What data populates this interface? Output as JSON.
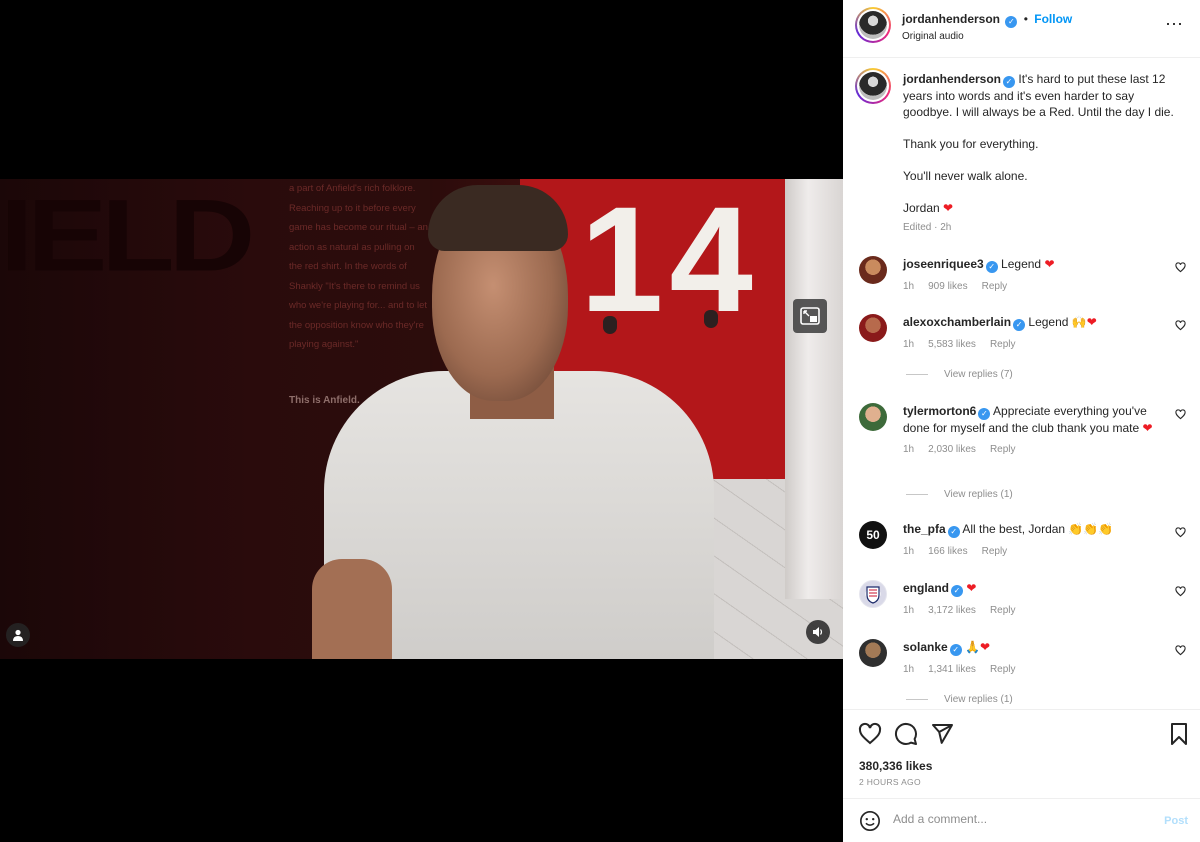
{
  "colors": {
    "accent": "#0095f6",
    "verified": "#3897f0",
    "heart": "#ed1c24",
    "muted": "#8e8e8e"
  },
  "video": {
    "wall_letters": "IELD",
    "quote": "a part of Anfield's rich folklore. Reaching up to it before every game has become our ritual – an action as natural as pulling on the red shirt. In the words of Shankly \"It's there to remind us who we're playing for... and to let the opposition know who they're playing against.\"",
    "quote_signature": "This is Anfield.",
    "jersey_number": "14",
    "buttons": {
      "user_icon": "user-icon",
      "sound_icon": "speaker-icon",
      "pip_icon": "picture-in-picture-icon"
    }
  },
  "header": {
    "username": "jordanhenderson",
    "separator": "•",
    "follow_label": "Follow",
    "audio": "Original audio",
    "more_icon": "more-horizontal-icon"
  },
  "caption": {
    "username": "jordanhenderson",
    "text1": "It's hard to put these last 12 years into words and it's even harder to say goodbye. I will always be a Red. Until the day I die.",
    "text2": "Thank you for everything.",
    "text3": "You'll never walk alone.",
    "text4": "Jordan",
    "meta": "Edited · 2h"
  },
  "comments": [
    {
      "username": "joseenriquee3",
      "text": "Legend",
      "emoji": "❤",
      "time": "1h",
      "likes": "909 likes",
      "reply": "Reply",
      "replies": ""
    },
    {
      "username": "alexoxchamberlain",
      "text": "Legend",
      "emoji": "🙌❤",
      "time": "1h",
      "likes": "5,583 likes",
      "reply": "Reply",
      "replies": "View replies (7)"
    },
    {
      "username": "tylermorton6",
      "text": "Appreciate everything you've done for myself and the club thank you mate",
      "emoji": "❤",
      "time": "1h",
      "likes": "2,030 likes",
      "reply": "Reply",
      "replies": "View replies (1)"
    },
    {
      "username": "the_pfa",
      "text": "All the best, Jordan",
      "emoji": "👏👏👏",
      "time": "1h",
      "likes": "166 likes",
      "reply": "Reply",
      "replies": ""
    },
    {
      "username": "england",
      "text": "",
      "emoji": "❤",
      "time": "1h",
      "likes": "3,172 likes",
      "reply": "Reply",
      "replies": ""
    },
    {
      "username": "solanke",
      "text": "",
      "emoji": "🙏❤",
      "time": "1h",
      "likes": "1,341 likes",
      "reply": "Reply",
      "replies": "View replies (1)"
    }
  ],
  "pfa_avatar_text": "50",
  "actions": {
    "likes": "380,336 likes",
    "ago": "2 HOURS AGO",
    "icons": [
      "heart-icon",
      "comment-icon",
      "share-icon",
      "bookmark-icon"
    ]
  },
  "add_comment": {
    "placeholder": "Add a comment...",
    "post_label": "Post"
  }
}
